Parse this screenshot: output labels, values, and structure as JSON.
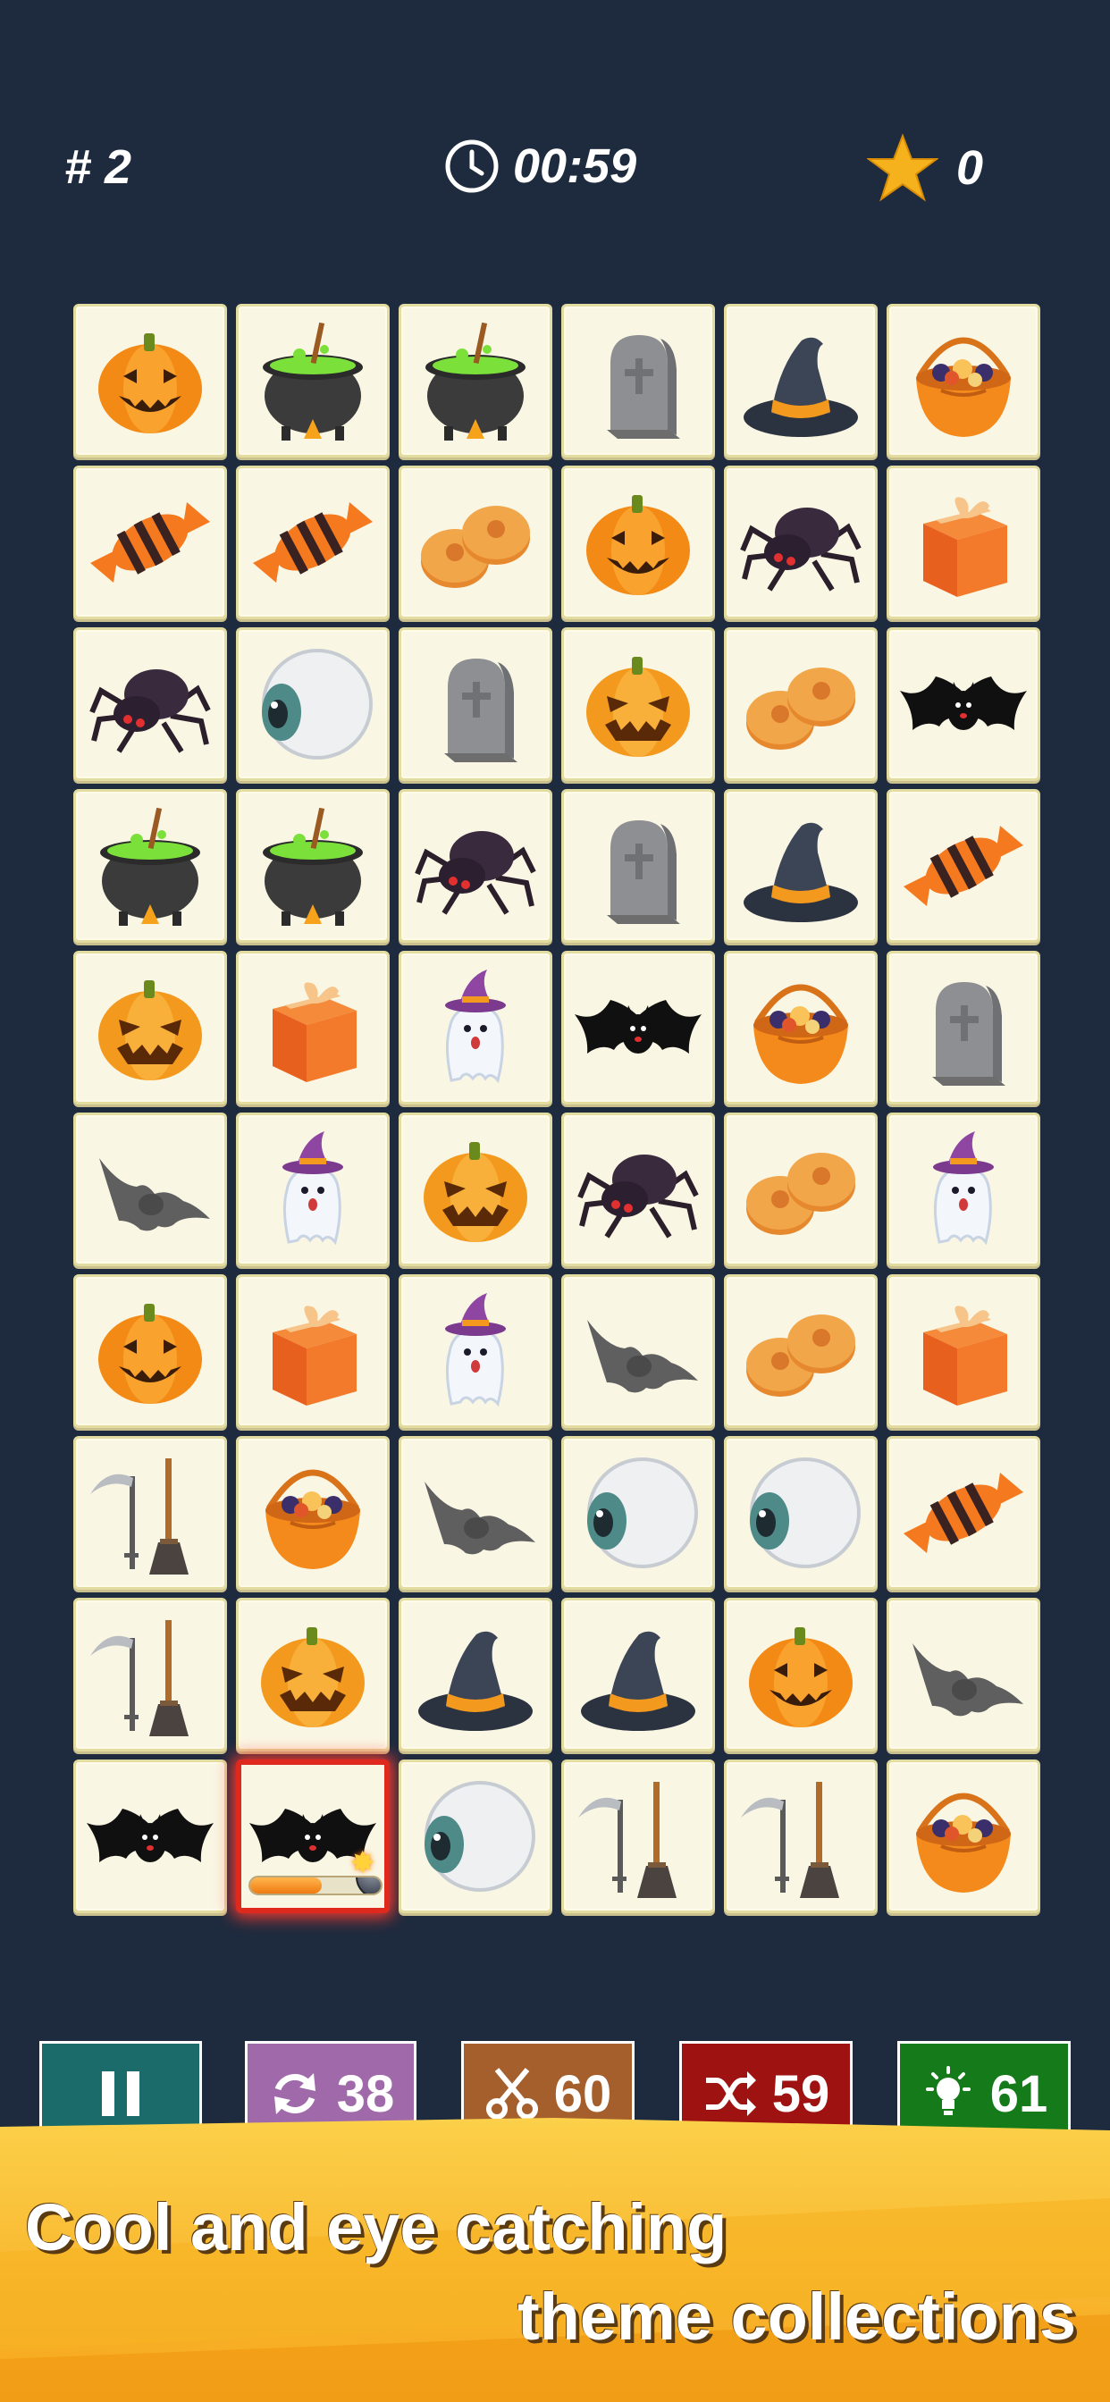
{
  "hud": {
    "level": "# 2",
    "timer": "00:59",
    "score": "0"
  },
  "board": {
    "rows": [
      [
        "pumpkin",
        "cauldron",
        "cauldron",
        "tombstone",
        "witch-hat",
        "candy-basket"
      ],
      [
        "candy",
        "candy",
        "cookies",
        "pumpkin",
        "spider",
        "gift-box"
      ],
      [
        "spider",
        "eyeball",
        "tombstone",
        "pumpkin-scary",
        "cookies",
        "bat-black"
      ],
      [
        "cauldron",
        "cauldron",
        "spider",
        "tombstone",
        "witch-hat",
        "candy"
      ],
      [
        "pumpkin-scary",
        "gift-box",
        "ghost",
        "bat-black",
        "candy-basket",
        "tombstone"
      ],
      [
        "bat-gray",
        "ghost",
        "pumpkin-scary",
        "spider",
        "cookies",
        "ghost"
      ],
      [
        "pumpkin",
        "gift-box",
        "ghost",
        "bat-gray",
        "cookies",
        "gift-box"
      ],
      [
        "scythe-broom",
        "candy-basket",
        "bat-gray",
        "eyeball",
        "eyeball",
        "candy"
      ],
      [
        "scythe-broom",
        "pumpkin-scary",
        "witch-hat",
        "witch-hat",
        "pumpkin",
        "bat-gray"
      ],
      [
        "bat-black",
        "bat-black",
        "eyeball",
        "scythe-broom",
        "scythe-broom",
        "candy-basket"
      ]
    ],
    "selected_tile": {
      "row": 9,
      "col": 1
    },
    "bomb_progress": 0.55
  },
  "buttons": {
    "pause": {
      "icon": "pause-icon"
    },
    "refresh": {
      "icon": "refresh-icon",
      "count": "38"
    },
    "scissors": {
      "icon": "scissors-icon",
      "count": "60"
    },
    "shuffle": {
      "icon": "shuffle-icon",
      "count": "59"
    },
    "hint": {
      "icon": "lightbulb-icon",
      "count": "61"
    }
  },
  "banner": {
    "line1": "Cool and eye catching",
    "line2": "theme collections"
  },
  "colors": {
    "background": "#1e2b3e",
    "tile": "#faf6e4",
    "pause": "#1a6b6a",
    "refresh": "#a06aaa",
    "scissors": "#a45f2c",
    "shuffle": "#9e1212",
    "hint": "#157a1a",
    "banner": "#f7b323"
  }
}
